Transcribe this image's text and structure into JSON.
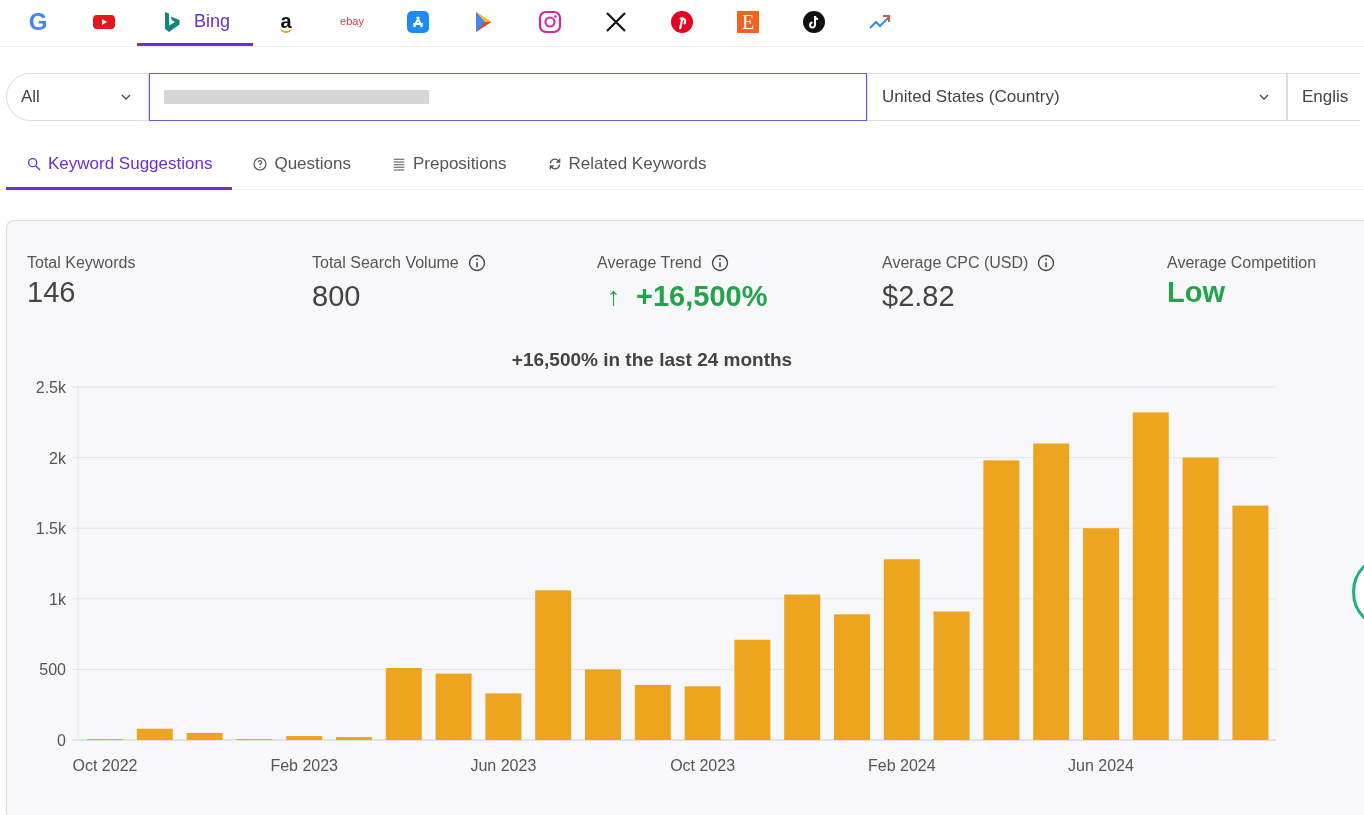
{
  "sources": [
    {
      "kind": "google",
      "glyph": "G",
      "selected": false
    },
    {
      "kind": "youtube",
      "selected": false
    },
    {
      "kind": "bing",
      "label": "Bing",
      "selected": true
    },
    {
      "kind": "amazon",
      "glyph": "a",
      "selected": false
    },
    {
      "kind": "ebay",
      "glyph": "ebay",
      "selected": false
    },
    {
      "kind": "appstore",
      "selected": false
    },
    {
      "kind": "playstore",
      "selected": false
    },
    {
      "kind": "instagram",
      "selected": false
    },
    {
      "kind": "x",
      "selected": false
    },
    {
      "kind": "pinterest",
      "selected": false
    },
    {
      "kind": "etsy",
      "glyph": "E",
      "selected": false
    },
    {
      "kind": "tiktok",
      "selected": false
    },
    {
      "kind": "trends",
      "selected": false
    }
  ],
  "search": {
    "category": "All",
    "country": "United States (Country)",
    "language": "Englis"
  },
  "tabs": [
    {
      "kind": "search",
      "label": "Keyword Suggestions",
      "selected": true
    },
    {
      "kind": "question",
      "label": "Questions",
      "selected": false
    },
    {
      "kind": "lines",
      "label": "Prepositions",
      "selected": false
    },
    {
      "kind": "refresh",
      "label": "Related Keywords",
      "selected": false
    }
  ],
  "stats": [
    {
      "label": "Total Keywords",
      "value": "146",
      "info": false,
      "color": "#444444"
    },
    {
      "label": "Total Search Volume",
      "value": "800",
      "info": true,
      "color": "#444444"
    },
    {
      "label": "Average Trend",
      "arrow": "↑",
      "value": "+16,500%",
      "info": true,
      "color": "#23a34a"
    },
    {
      "label": "Average CPC (USD)",
      "value": "$2.82",
      "info": true,
      "color": "#444444"
    },
    {
      "label": "Average Competition",
      "value": "Low",
      "info": false,
      "color": "#23a34a"
    }
  ],
  "chart_data": {
    "type": "bar",
    "title": "+16,500% in the last 24 months",
    "categories": [
      "Oct 2022",
      null,
      null,
      null,
      "Feb 2023",
      null,
      null,
      null,
      "Jun 2023",
      null,
      null,
      null,
      "Oct 2023",
      null,
      null,
      null,
      "Feb 2024",
      null,
      null,
      null,
      "Jun 2024",
      null,
      null,
      null
    ],
    "series": [
      {
        "color": "#eda41f",
        "values": [
          7,
          80,
          50,
          7,
          28,
          21,
          510,
          470,
          330,
          1060,
          500,
          390,
          380,
          710,
          1030,
          890,
          1280,
          910,
          1980,
          2100,
          1500,
          2320,
          2000,
          1660
        ]
      }
    ],
    "ylim": [
      0,
      2500
    ],
    "grid": true,
    "yticks": [
      {
        "value": 0,
        "label": "0"
      },
      {
        "value": 500,
        "label": "500"
      },
      {
        "value": 1000,
        "label": "1k"
      },
      {
        "value": 1500,
        "label": "1.5k"
      },
      {
        "value": 2000,
        "label": "2k"
      },
      {
        "value": 2500,
        "label": "2.5k"
      }
    ]
  }
}
